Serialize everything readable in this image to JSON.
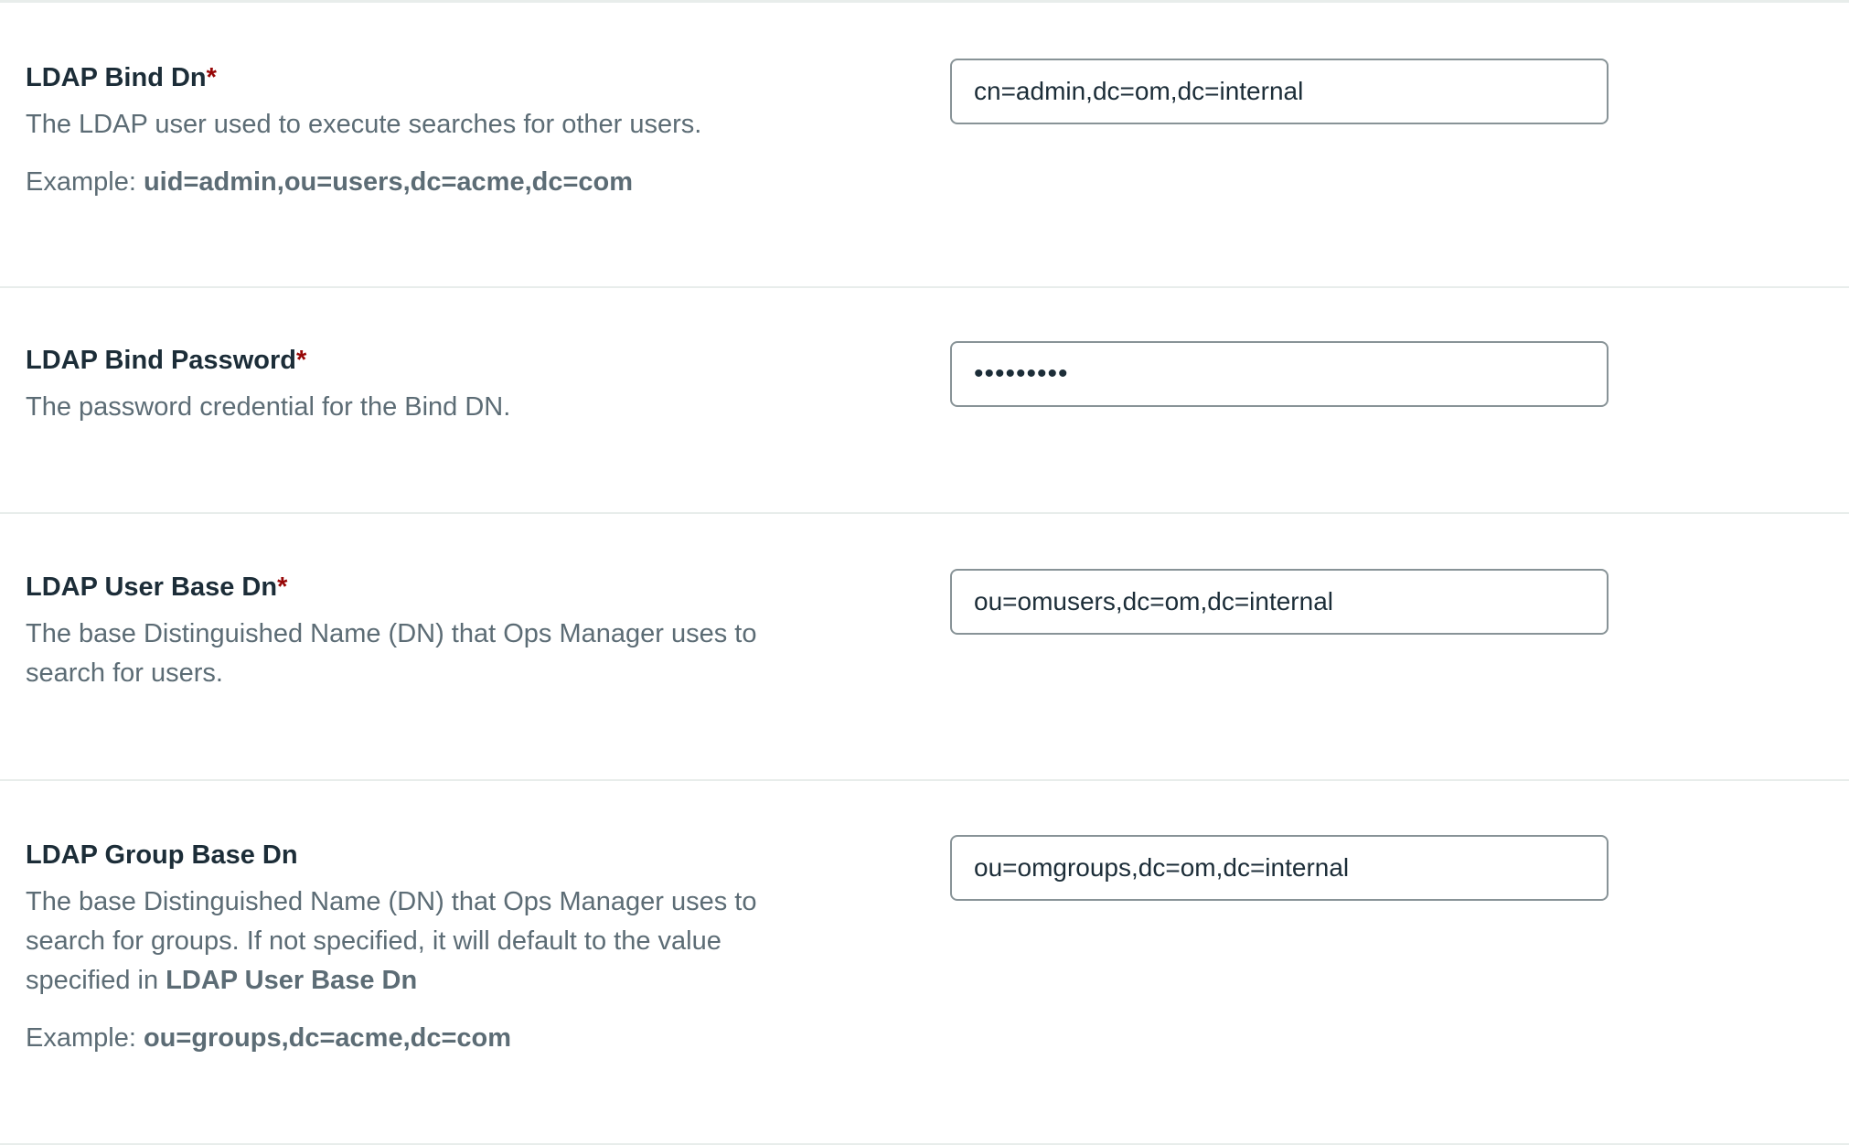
{
  "settings": [
    {
      "title": "LDAP Bind Dn",
      "required_mark": "*",
      "description": "The LDAP user used to execute searches for other users.",
      "example_prefix": "Example: ",
      "example_value": "uid=admin,ou=users,dc=acme,dc=com",
      "input_value": "cn=admin,dc=om,dc=internal"
    },
    {
      "title": "LDAP Bind Password",
      "required_mark": "*",
      "description": "The password credential for the Bind DN.",
      "input_value": "•••••••••"
    },
    {
      "title": "LDAP User Base Dn",
      "required_mark": "*",
      "description": "The base Distinguished Name (DN) that Ops Manager uses to search for users.",
      "input_value": "ou=omusers,dc=om,dc=internal"
    },
    {
      "title": "LDAP Group Base Dn",
      "required_mark": "",
      "description": "The base Distinguished Name (DN) that Ops Manager uses to search for groups. If not specified, it will default to the value specified in ",
      "description_bold": "LDAP User Base Dn",
      "example_prefix": "Example: ",
      "example_value": "ou=groups,dc=acme,dc=com",
      "input_value": "ou=omgroups,dc=om,dc=internal"
    }
  ],
  "colors": {
    "heading": "#1c2d38",
    "body_text": "#5c6c75",
    "required_mark": "#970606",
    "input_border": "#889397",
    "divider": "#e8edeb"
  }
}
